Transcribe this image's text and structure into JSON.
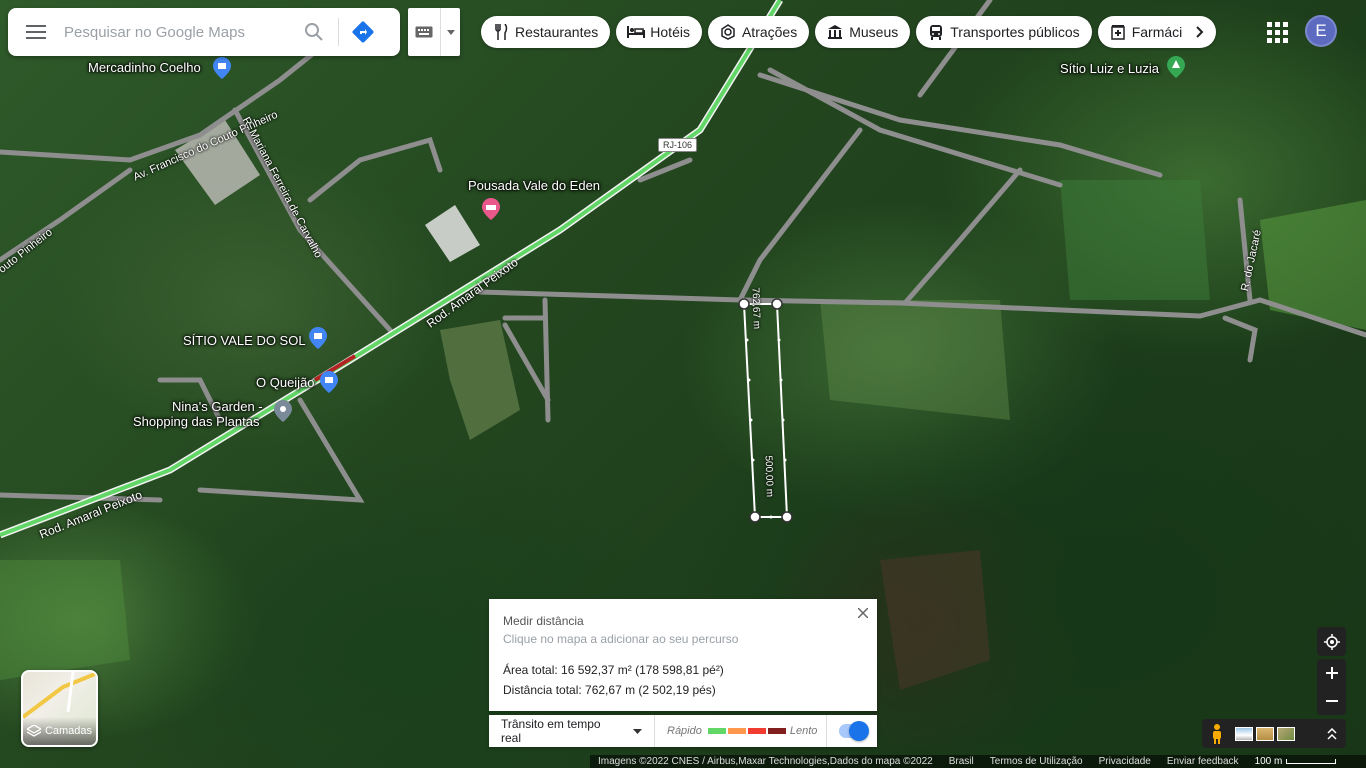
{
  "search": {
    "placeholder": "Pesquisar no Google Maps"
  },
  "chips": [
    {
      "label": "Restaurantes",
      "icon": "fork-knife-icon"
    },
    {
      "label": "Hotéis",
      "icon": "bed-icon"
    },
    {
      "label": "Atrações",
      "icon": "camera-icon"
    },
    {
      "label": "Museus",
      "icon": "museum-icon"
    },
    {
      "label": "Transportes públicos",
      "icon": "bus-icon"
    },
    {
      "label": "Farmáci",
      "icon": "pharmacy-icon"
    }
  ],
  "account": {
    "initial": "E",
    "color": "#5c6bc0"
  },
  "places": {
    "mercadinho": "Mercadinho Coelho",
    "sitio_luiz": "Sítio Luiz e Luzia",
    "pousada": "Pousada Vale do Eden",
    "sitio_vale": "SÍTIO VALE DO SOL",
    "queijao": "O Queijão",
    "ninas_1": "Nina's Garden -",
    "ninas_2": "Shopping das Plantas"
  },
  "roads": {
    "av_francisco": "Av. Francisco do Couto Pinheiro",
    "couto": "outo Pinheiro",
    "mariana": "R. Mariana Ferreira de Carvalho",
    "amaral_1": "Rod. Amaral Peixoto",
    "amaral_2": "Rod. Amaral Peixoto",
    "jacare": "R. do Jacaré",
    "rj106": "RJ-106"
  },
  "measurement": {
    "seg1": "762,67 m",
    "seg2": "500,00 m"
  },
  "measure_panel": {
    "title": "Medir distância",
    "hint": "Clique no mapa a adicionar ao seu percurso",
    "area": "Área total: 16 592,37 m² (178 598,81 pé²)",
    "distance": "Distância total: 762,67 m (2 502,19 pés)"
  },
  "traffic": {
    "select_label": "Trânsito em tempo real",
    "fast": "Rápido",
    "slow": "Lento",
    "colors": [
      "#63d668",
      "#ff974d",
      "#f23c32",
      "#811f1f"
    ]
  },
  "layers": {
    "label": "Camadas"
  },
  "footer": {
    "imagery": "Imagens ©2022 CNES / Airbus,Maxar Technologies,Dados do mapa ©2022",
    "country": "Brasil",
    "terms": "Termos de Utilização",
    "privacy": "Privacidade",
    "feedback": "Enviar feedback",
    "scale": "100 m"
  }
}
